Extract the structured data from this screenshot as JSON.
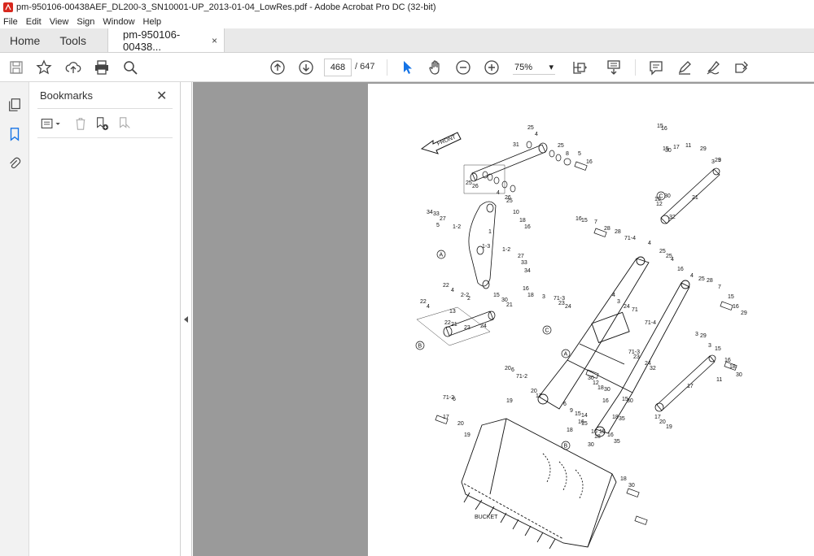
{
  "window": {
    "title": "pm-950106-00438AEF_DL200-3_SN10001-UP_2013-01-04_LowRes.pdf - Adobe Acrobat Pro DC (32-bit)"
  },
  "menu": [
    "File",
    "Edit",
    "View",
    "Sign",
    "Window",
    "Help"
  ],
  "tabs": {
    "home": "Home",
    "tools": "Tools",
    "document": "pm-950106-00438...",
    "close": "×"
  },
  "toolbar": {
    "current_page": "468",
    "total_pages": "/ 647",
    "zoom": "75%",
    "zoom_arrow": "▾"
  },
  "bookmarks": {
    "title": "Bookmarks",
    "close": "✕"
  },
  "diagram": {
    "front_label": "FRONT",
    "bucket_label": "BUCKET",
    "circle_labels": [
      "A",
      "B",
      "C"
    ],
    "part_numbers": [
      "25",
      "4",
      "31",
      "25",
      "8",
      "5",
      "16",
      "15",
      "16",
      "15",
      "30",
      "17",
      "11",
      "29",
      "3",
      "29",
      "3",
      "25",
      "26",
      "4",
      "26",
      "25",
      "34",
      "33",
      "27",
      "5",
      "1-2",
      "1",
      "10",
      "18",
      "16",
      "1-3",
      "1-2",
      "27",
      "33",
      "34",
      "16",
      "15",
      "7",
      "28",
      "28",
      "71-4",
      "4",
      "25",
      "25",
      "4",
      "16",
      "30",
      "15",
      "12",
      "32",
      "21",
      "22",
      "4",
      "2-2",
      "2",
      "13",
      "15",
      "16",
      "18",
      "30",
      "21",
      "22",
      "4",
      "22",
      "21",
      "23",
      "24",
      "3",
      "71-3",
      "23",
      "24",
      "4",
      "3",
      "24",
      "71",
      "71-4",
      "4",
      "25",
      "28",
      "7",
      "15",
      "16",
      "29",
      "3",
      "29",
      "3",
      "15",
      "16",
      "18",
      "30",
      "11",
      "71-3",
      "23",
      "24",
      "32",
      "17",
      "20",
      "6",
      "71-2",
      "19",
      "20",
      "17",
      "6",
      "9",
      "15",
      "16",
      "18",
      "30",
      "12",
      "18",
      "30",
      "16",
      "15",
      "30",
      "18",
      "35",
      "17",
      "20",
      "19",
      "71-2",
      "6",
      "17",
      "20",
      "19",
      "14",
      "15",
      "16",
      "18",
      "30",
      "15",
      "16",
      "35",
      "18",
      "30"
    ]
  },
  "colors": {
    "accent": "#1473e6",
    "tab_bg": "#e9e9e9",
    "doc_bg": "#9a9a9a"
  }
}
